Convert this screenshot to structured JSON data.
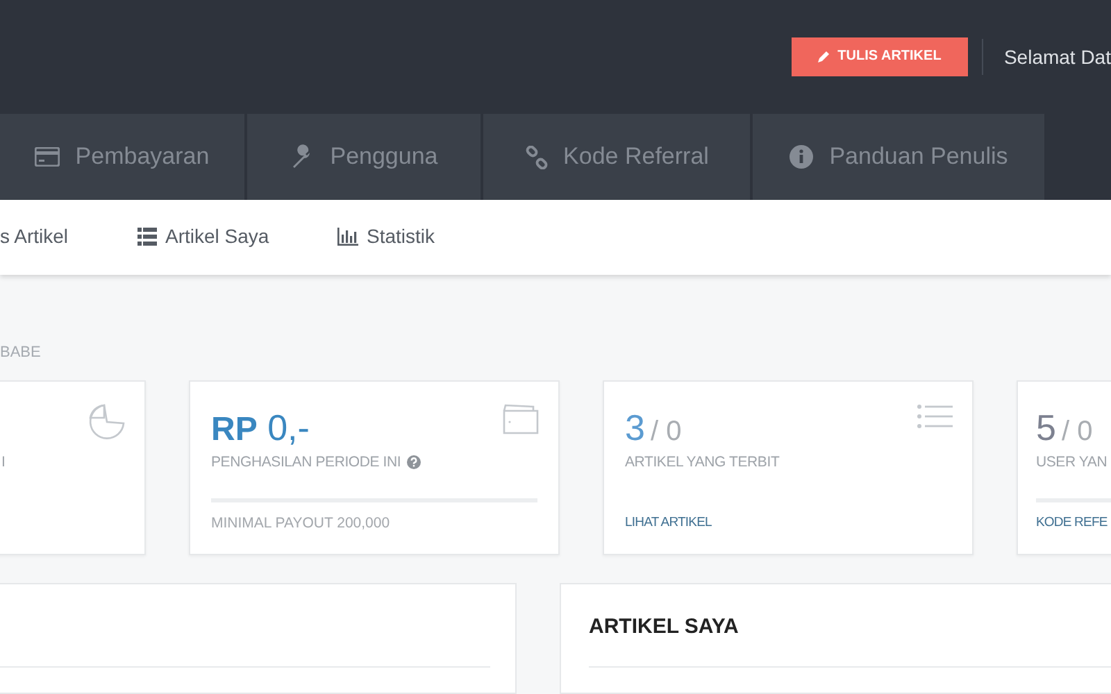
{
  "header": {
    "write_button": "TULIS ARTIKEL",
    "greeting": "Selamat Dat"
  },
  "tabs": [
    {
      "label": "Pembayaran",
      "selected": false
    },
    {
      "label": "Pengguna",
      "selected": false
    },
    {
      "label": "Kode Referral",
      "selected": false
    },
    {
      "label": "Panduan Penulis",
      "selected": false
    }
  ],
  "subnav": [
    {
      "label": "s Artikel"
    },
    {
      "label": "Artikel Saya"
    },
    {
      "label": "Statistik"
    }
  ],
  "section_label": "BABE",
  "cards": [
    {
      "label": "I"
    },
    {
      "value": "**RP** 0,-",
      "label": "PENGHASILAN PERIODE INI",
      "footer": "MINIMAL PAYOUT 200,000"
    },
    {
      "value": "3",
      "suffix": "/ 0",
      "label": "ARTIKEL YANG TERBIT",
      "link": "LIHAT ARTIKEL"
    },
    {
      "value": "5",
      "suffix": "/ 0",
      "label": "USER YAN",
      "link": "KODE REFE"
    }
  ],
  "panels": [
    {
      "title": "ARTIKEL SAYA"
    }
  ]
}
